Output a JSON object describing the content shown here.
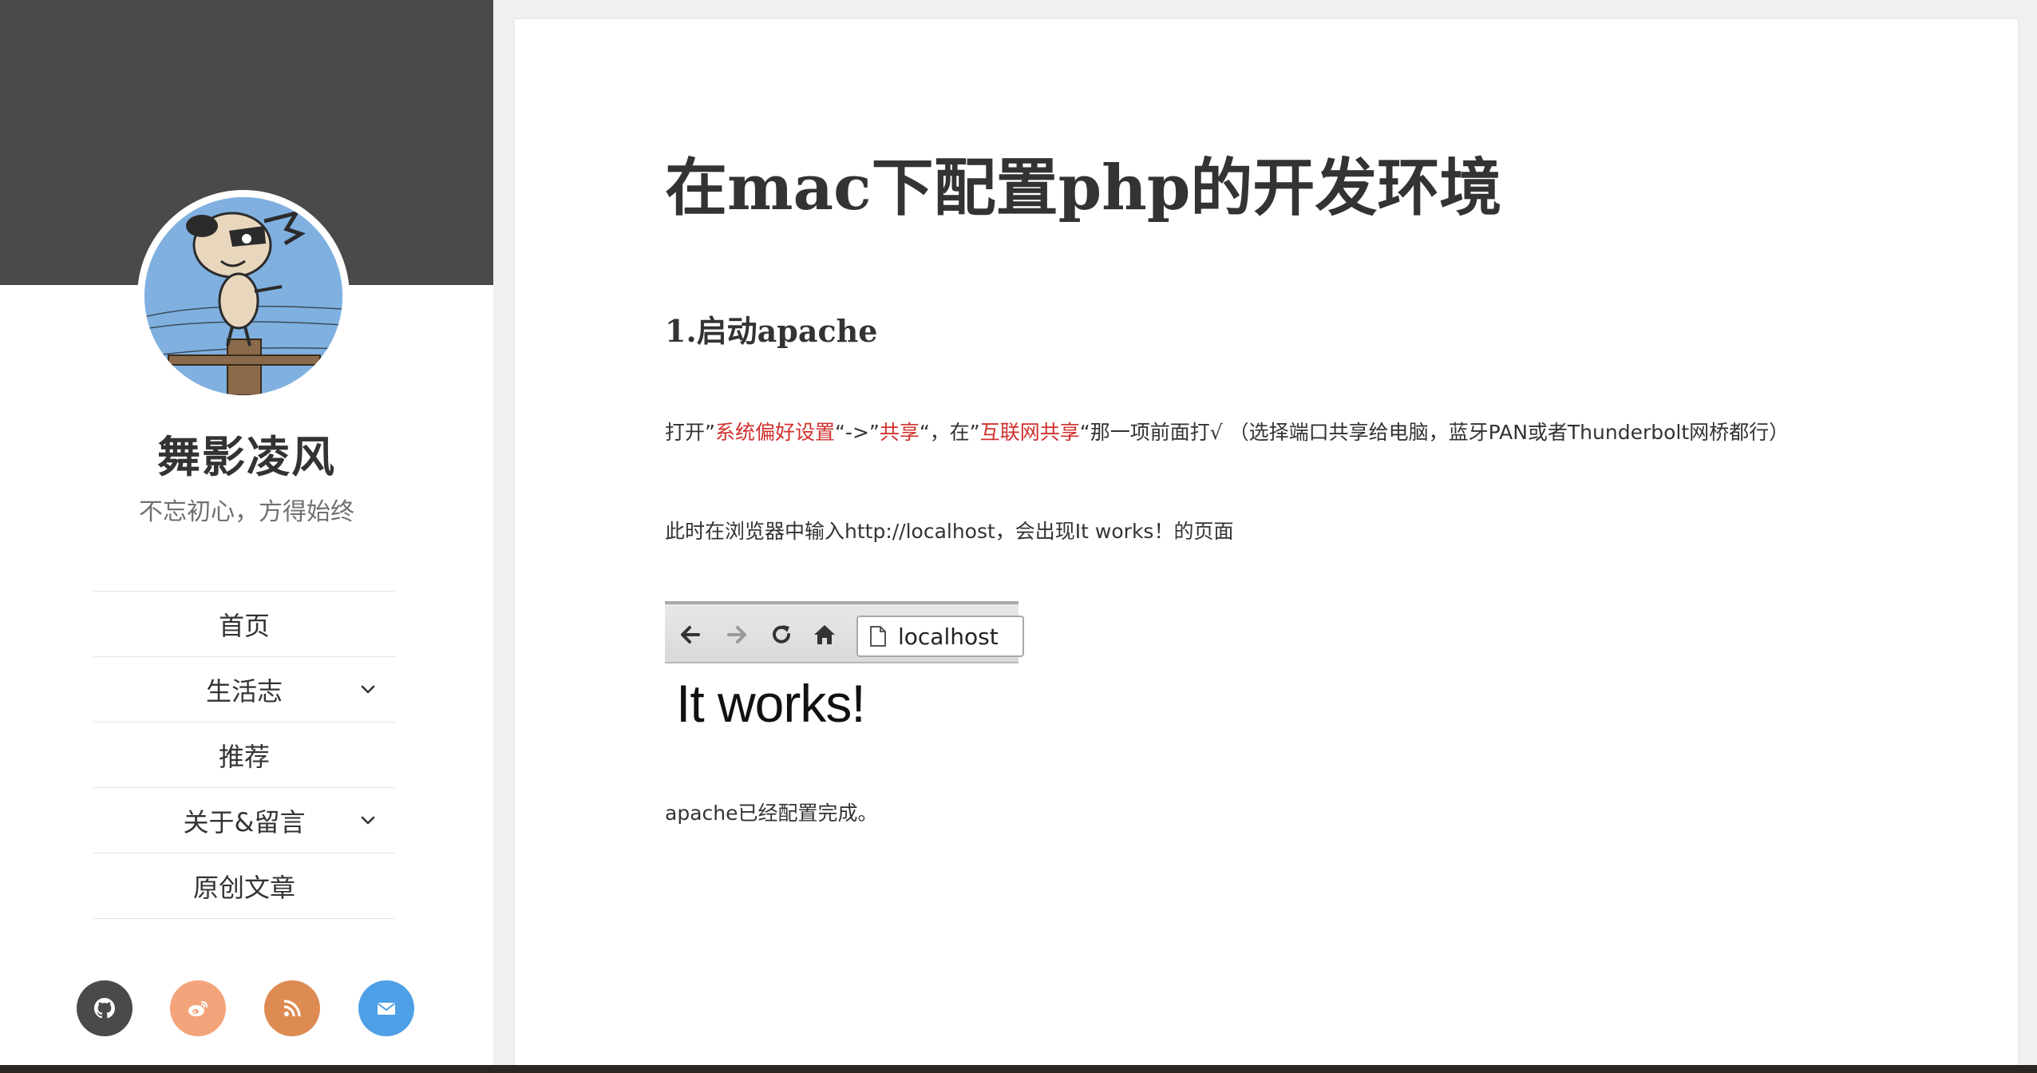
{
  "site": {
    "title": "舞影凌风",
    "description": "不忘初心，方得始终"
  },
  "nav": {
    "items": [
      {
        "label": "首页",
        "has_submenu": false
      },
      {
        "label": "生活志",
        "has_submenu": true
      },
      {
        "label": "推荐",
        "has_submenu": false
      },
      {
        "label": "关于&留言",
        "has_submenu": true
      },
      {
        "label": "原创文章",
        "has_submenu": false
      }
    ]
  },
  "social": [
    {
      "name": "github-icon",
      "color": "#4a4a4a"
    },
    {
      "name": "weibo-icon",
      "color": "#f4a47a"
    },
    {
      "name": "rss-icon",
      "color": "#dd8b52"
    },
    {
      "name": "email-icon",
      "color": "#4d9fe6"
    }
  ],
  "post": {
    "title": "在mac下配置php的开发环境",
    "section1_heading": "1.启动apache",
    "p1": {
      "t0": "打开”",
      "hl1": "系统偏好设置",
      "t1": "“->”",
      "hl2": "共享",
      "t2": "“，在”",
      "hl3": "互联网共享",
      "t3": "“那一项前面打√ （选择端口共享给电脑，蓝牙PAN或者Thunderbolt网桥都行）"
    },
    "p2": "此时在浏览器中输入http://localhost，会出现It works！的页面",
    "screenshot": {
      "url": "localhost",
      "body_text": "It works!"
    },
    "p3": "apache已经配置完成。"
  },
  "colors": {
    "highlight": "#d0312d",
    "sidebar_header": "#4a4a4a",
    "page_bg": "#f0f0f0"
  }
}
